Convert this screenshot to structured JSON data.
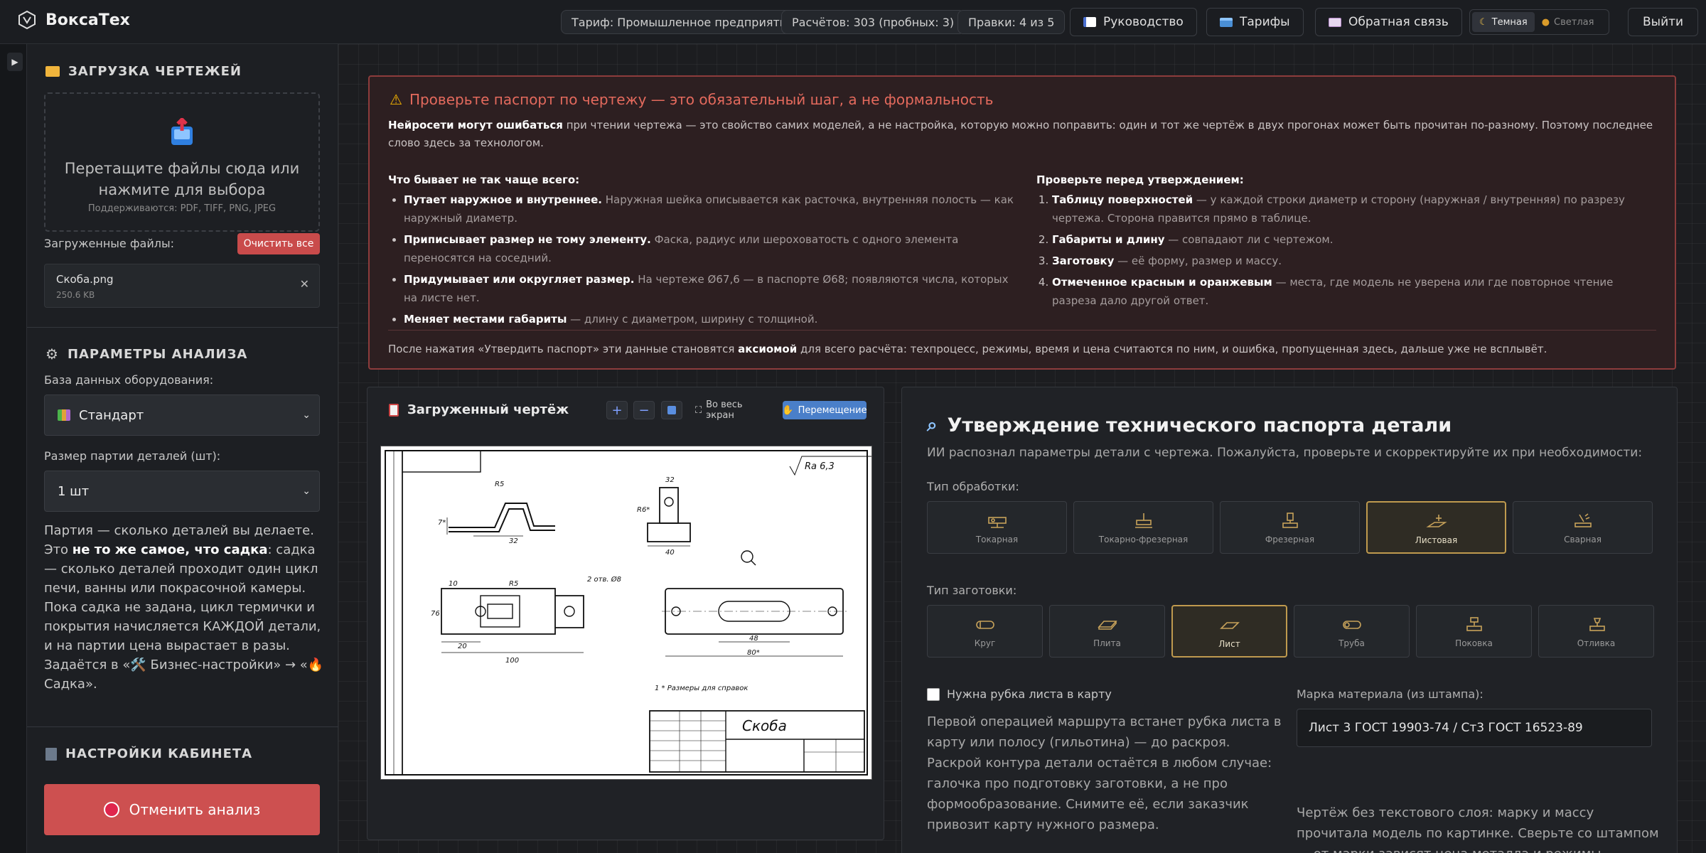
{
  "header": {
    "app_name": "ВоксаТех",
    "tariff": "Тариф: Промышленное предприятие",
    "calcs": "Расчётов: 303 (пробных: 3)",
    "edits": "Правки: 4 из 5",
    "guide": "Руководство",
    "tariffs": "Тарифы",
    "feedback": "Обратная связь",
    "theme_dark": "Темная",
    "theme_light": "Светлая",
    "logout": "Выйти"
  },
  "sidebar": {
    "upload_title": "ЗАГРУЗКА ЧЕРТЕЖЕЙ",
    "drop_main": "Перетащите файлы сюда или нажмите для выбора",
    "drop_formats": "Поддерживаются: PDF, TIFF, PNG, JPEG",
    "uploaded_label": "Загруженные файлы:",
    "clear_all": "Очистить все",
    "file": {
      "name": "Скоба.png",
      "size": "250.6 KB"
    },
    "params_title": "ПАРАМЕТРЫ АНАЛИЗА",
    "db_label": "База данных оборудования:",
    "db_value": "Стандарт",
    "batch_label": "Размер партии деталей (шт):",
    "batch_value": "1 шт",
    "note_1": "Партия — сколько деталей вы делаете. Это ",
    "note_bold": "не то же самое, что садка",
    "note_2": ": садка — сколько деталей проходит один цикл печи, ванны или покрасочной камеры. Пока садка не задана, цикл термички и покрытия начисляется КАЖДОЙ детали, и на партии цена вырастает в разы. Задаётся в «🛠️ Бизнес-настройки» → «🔥 Садка».",
    "cabinet_title": "НАСТРОЙКИ КАБИНЕТА",
    "cancel": "Отменить анализ"
  },
  "warning": {
    "title": "Проверьте паспорт по чертежу — это обязательный шаг, а не формальность",
    "p_bold": "Нейросети могут ошибаться",
    "p_rest": " при чтении чертежа — это свойство самих моделей, а не настройка, которую можно поправить: один и тот же чертёж в двух прогонах может быть прочитан по-разному. Поэтому последнее слово здесь за технологом.",
    "left_title": "Что бывает не так чаще всего:",
    "left_items": [
      {
        "b": "Путает наружное и внутреннее.",
        "d": " Наружная шейка описывается как расточка, внутренняя полость — как наружный диаметр."
      },
      {
        "b": "Приписывает размер не тому элементу.",
        "d": " Фаска, радиус или шероховатость с одного элемента переносятся на соседний."
      },
      {
        "b": "Придумывает или округляет размер.",
        "d": " На чертеже Ø67,6 — в паспорте Ø68; появляются числа, которых на листе нет."
      },
      {
        "b": "Меняет местами габариты",
        "d": " — длину с диаметром, ширину с толщиной."
      }
    ],
    "right_title": "Проверьте перед утверждением:",
    "right_items": [
      {
        "b": "Таблицу поверхностей",
        "d": " — у каждой строки диаметр и сторону (наружная / внутренняя) по разрезу чертежа. Сторона правится прямо в таблице."
      },
      {
        "b": "Габариты и длину",
        "d": " — совпадают ли с чертежом."
      },
      {
        "b": "Заготовку",
        "d": " — её форму, размер и массу."
      },
      {
        "b": "Отмеченное красным и оранжевым",
        "d": " — места, где модель не уверена или где повторное чтение разреза дало другой ответ."
      }
    ],
    "foot_1": "После нажатия «Утвердить паспорт» эти данные становятся ",
    "foot_bold": "аксиомой",
    "foot_2": " для всего расчёта: техпроцесс, режимы, время и цена считаются по ним, и ошибка, пропущенная здесь, дальше уже не всплывёт."
  },
  "drawing": {
    "title": "Загруженный чертёж",
    "fullscreen": "Во весь экран",
    "move": "Перемещение",
    "zoom_in": "+",
    "zoom_out": "−",
    "labels": {
      "roughness": "Ra 6,3",
      "note": "1  * Размеры для справок",
      "stamp_name": "Скоба",
      "holes": "2 отв. Ø8",
      "d_r5": "R5",
      "d_r6": "R6*",
      "d_7": "7*",
      "d_32": "32",
      "d_40": "40",
      "d_10": "10",
      "d_20": "20",
      "d_100": "100",
      "d_76": "76",
      "d_48": "48",
      "d_80": "80*"
    }
  },
  "passport": {
    "title": "Утверждение технического паспорта детали",
    "subtitle": "ИИ распознал параметры детали с чертежа. Пожалуйста, проверьте и скорректируйте их при необходимости:",
    "processing_label": "Тип обработки:",
    "processing": [
      {
        "label": "Токарная",
        "icon": "lathe-icon"
      },
      {
        "label": "Токарно-фрезерная",
        "icon": "mill-turn-icon"
      },
      {
        "label": "Фрезерная",
        "icon": "milling-icon"
      },
      {
        "label": "Листовая",
        "icon": "sheet-metal-icon",
        "selected": true
      },
      {
        "label": "Сварная",
        "icon": "welding-icon"
      }
    ],
    "blank_label": "Тип заготовки:",
    "blanks": [
      {
        "label": "Круг",
        "icon": "round-bar-icon"
      },
      {
        "label": "Плита",
        "icon": "plate-icon"
      },
      {
        "label": "Лист",
        "icon": "sheet-icon",
        "selected": true
      },
      {
        "label": "Труба",
        "icon": "tube-icon"
      },
      {
        "label": "Поковка",
        "icon": "forging-icon"
      },
      {
        "label": "Отливка",
        "icon": "casting-icon"
      }
    ],
    "cut_checkbox": "Нужна рубка листа в карту",
    "cut_text": "Первой операцией маршрута встанет рубка листа в карту или полосу (гильотина) — до раскроя. Раскрой контура детали остаётся в любом случае: галочка про подготовку заготовки, а не про формообразование. Снимите её, если заказчик привозит карту нужного размера.",
    "material_label": "Марка материала (из штампа):",
    "material_value": "Лист 3 ГОСТ 19903-74 / Ст3 ГОСТ 16523-89",
    "material_note": "Чертёж без текстового слоя: марку и массу прочитала модель по картинке. Сверьте со штампом — от марки зависят цена металла и режимы резания."
  },
  "colors": {
    "accent": "#bf9a4e",
    "danger": "#c94b4b",
    "warning_title": "#e46a5d"
  }
}
